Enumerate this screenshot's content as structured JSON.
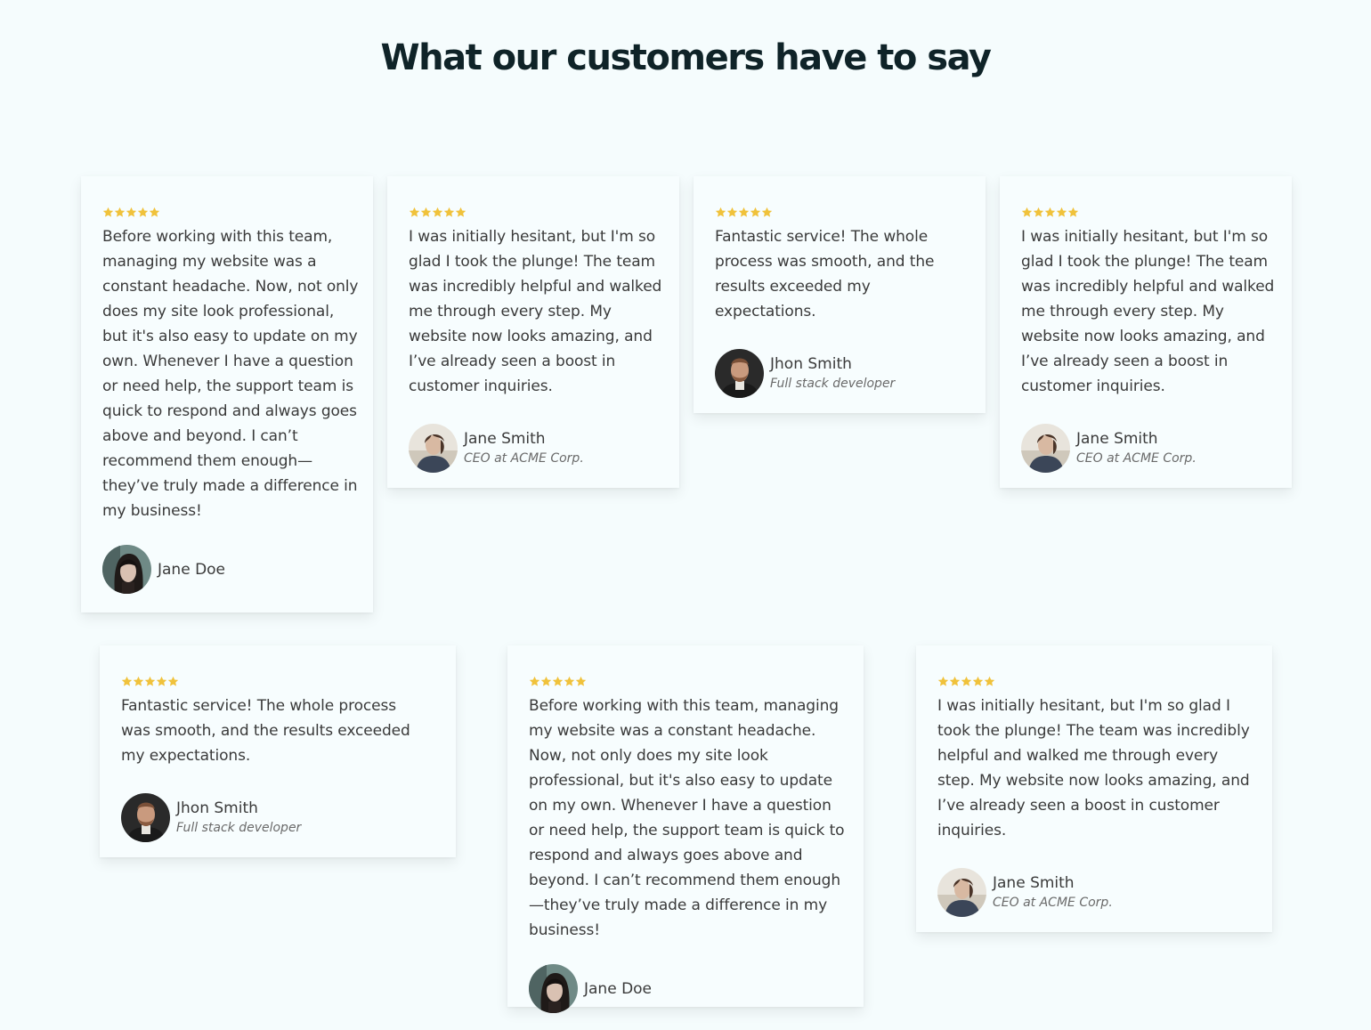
{
  "page": {
    "title": "What our customers have to say",
    "background": "#f5fcfd",
    "star_color": "#f0c23b"
  },
  "testimonials": [
    {
      "rating": 5,
      "quote": "Before working with this team, managing my website was a constant headache. Now, not only does my site look professional, but it's also easy to update on my own. Whenever I have a question or need help, the support team is quick to respond and always goes above and beyond. I can’t recommend them enough—they’ve truly made a difference in my business!",
      "name": "Jane Doe",
      "role": "",
      "avatar": "jane-doe-avatar"
    },
    {
      "rating": 5,
      "quote": "I was initially hesitant, but I'm so glad I took the plunge! The team was incredibly helpful and walked me through every step. My website now looks amazing, and I’ve already seen a boost in customer inquiries.",
      "name": "Jane Smith",
      "role": "CEO at ACME Corp.",
      "avatar": "jane-smith-avatar"
    },
    {
      "rating": 5,
      "quote": "Fantastic service! The whole process was smooth, and the results exceeded my expectations.",
      "name": "Jhon Smith",
      "role": "Full stack developer",
      "avatar": "jhon-smith-avatar"
    },
    {
      "rating": 5,
      "quote": "I was initially hesitant, but I'm so glad I took the plunge! The team was incredibly helpful and walked me through every step. My website now looks amazing, and I’ve already seen a boost in customer inquiries.",
      "name": "Jane Smith",
      "role": "CEO at ACME Corp.",
      "avatar": "jane-smith-avatar"
    },
    {
      "rating": 5,
      "quote": "Fantastic service! The whole process was smooth, and the results exceeded my expectations.",
      "name": "Jhon Smith",
      "role": "Full stack developer",
      "avatar": "jhon-smith-avatar"
    },
    {
      "rating": 5,
      "quote": "Before working with this team, managing my website was a constant headache. Now, not only does my site look professional, but it's also easy to update on my own. Whenever I have a question or need help, the support team is quick to respond and always goes above and beyond. I can’t recommend them enough—they’ve truly made a difference in my business!",
      "name": "Jane Doe",
      "role": "",
      "avatar": "jane-doe-avatar"
    },
    {
      "rating": 5,
      "quote": "I was initially hesitant, but I'm so glad I took the plunge! The team was incredibly helpful and walked me through every step. My website now looks amazing, and I’ve already seen a boost in customer inquiries.",
      "name": "Jane Smith",
      "role": "CEO at ACME Corp.",
      "avatar": "jane-smith-avatar"
    }
  ]
}
